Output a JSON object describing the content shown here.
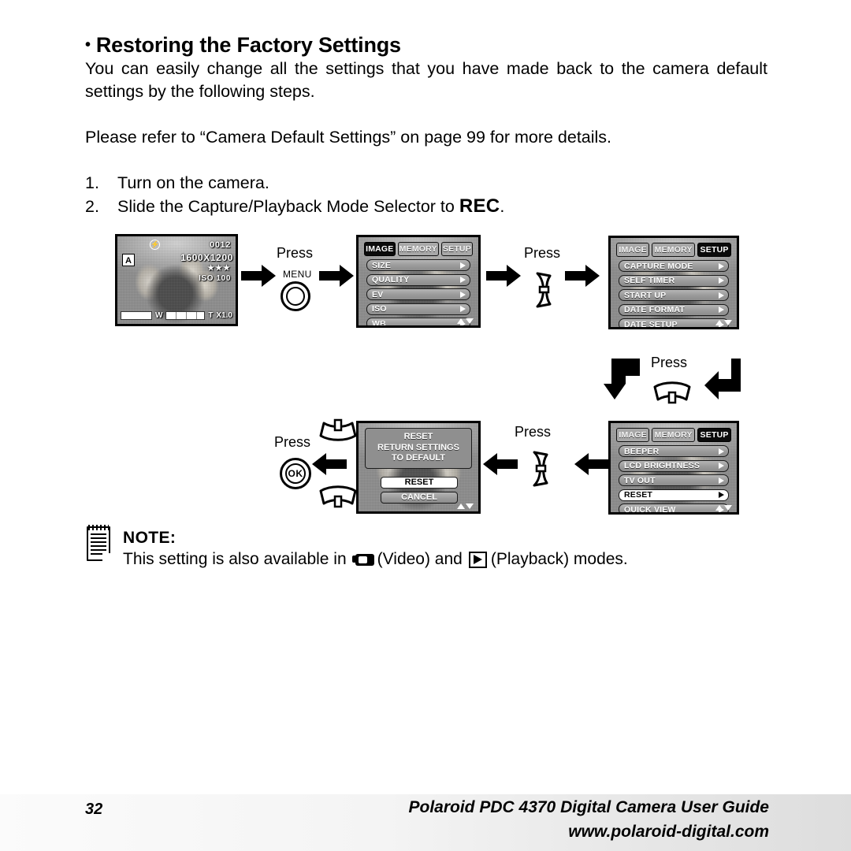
{
  "page": {
    "heading": "Restoring the Factory Settings",
    "bullet": "•",
    "intro": "You can easily change all the settings that you have made back to the camera default settings by the following steps.",
    "refer": "Please refer to “Camera Default Settings” on page 99 for more details."
  },
  "steps": [
    {
      "num": "1.",
      "text": "Turn on the camera."
    },
    {
      "num": "2.",
      "text_before": "Slide the Capture/Playback Mode Selector to ",
      "emphasis": "REC",
      "text_after": "."
    }
  ],
  "labels": {
    "press": "Press",
    "menu_button": "MENU",
    "ok_button": "OK"
  },
  "lcd_preview": {
    "frame_count": "0012",
    "resolution": "1600X1200",
    "quality_stars": "★★★",
    "iso": "ISO 100",
    "flash_icon": "flash-off-icon",
    "auto_icon": "A",
    "zoom_wide": "W",
    "zoom_tele": "T",
    "zoom_factor": "X1.0"
  },
  "menu_image": {
    "tabs": [
      {
        "label": "IMAGE",
        "active": true
      },
      {
        "label": "MEMORY",
        "active": false
      },
      {
        "label": "SETUP",
        "active": false
      }
    ],
    "items": [
      {
        "label": "SIZE",
        "selected": false
      },
      {
        "label": "QUALITY",
        "selected": false
      },
      {
        "label": "EV",
        "selected": false
      },
      {
        "label": "ISO",
        "selected": false
      },
      {
        "label": "WB",
        "selected": false
      }
    ]
  },
  "menu_setup_1": {
    "tabs": [
      {
        "label": "IMAGE",
        "active": false
      },
      {
        "label": "MEMORY",
        "active": false
      },
      {
        "label": "SETUP",
        "active": true
      }
    ],
    "items": [
      {
        "label": "CAPTURE MODE",
        "selected": false
      },
      {
        "label": "SELF TIMER",
        "selected": false
      },
      {
        "label": "START UP",
        "selected": false
      },
      {
        "label": "DATE FORMAT",
        "selected": false
      },
      {
        "label": "DATE SETUP",
        "selected": false
      }
    ]
  },
  "menu_setup_2": {
    "tabs": [
      {
        "label": "IMAGE",
        "active": false
      },
      {
        "label": "MEMORY",
        "active": false
      },
      {
        "label": "SETUP",
        "active": true
      }
    ],
    "items": [
      {
        "label": "BEEPER",
        "selected": false
      },
      {
        "label": "LCD BRIGHTNESS",
        "selected": false
      },
      {
        "label": "TV OUT",
        "selected": false
      },
      {
        "label": "RESET",
        "selected": true
      },
      {
        "label": "QUICK VIEW",
        "selected": false
      }
    ]
  },
  "reset_dialog": {
    "title": "RESET",
    "message_line1": "RETURN SETTINGS",
    "message_line2": "TO DEFAULT",
    "buttons": [
      {
        "label": "RESET",
        "selected": true
      },
      {
        "label": "CANCEL",
        "selected": false
      }
    ]
  },
  "note": {
    "title": "NOTE:",
    "text_before": "This setting is also available in",
    "video_label": "(Video) and",
    "playback_label": "(Playback) modes.",
    "video_icon": "video-camera-icon",
    "playback_icon": "playback-icon",
    "note_icon": "notepad-icon"
  },
  "footer": {
    "page_number": "32",
    "guide": "Polaroid PDC 4370 Digital Camera User Guide",
    "url": "www.polaroid-digital.com"
  }
}
